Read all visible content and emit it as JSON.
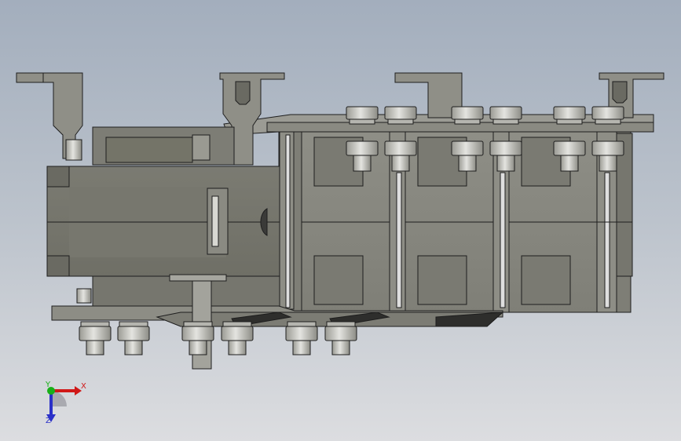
{
  "viewport": {
    "background_top": "#a3aebd",
    "background_bottom": "#dcdde0"
  },
  "model": {
    "part_color": "#85857c",
    "part_color_light": "#a6a69f",
    "edge_color": "#1e1e1e",
    "shadow_color": "#2e2e2c"
  },
  "triad": {
    "x_label": "X",
    "y_label": "Y",
    "z_label": "Z",
    "x_color": "#d01818",
    "y_color": "#18b018",
    "z_color": "#2a30c8"
  }
}
